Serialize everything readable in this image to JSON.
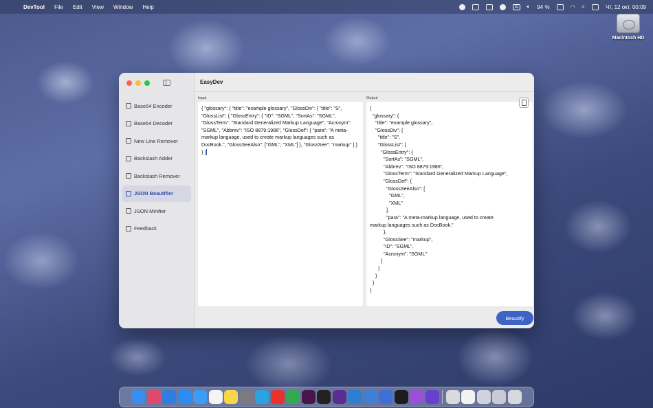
{
  "menubar": {
    "app_name": "DevTool",
    "menus": [
      "File",
      "Edit",
      "View",
      "Window",
      "Help"
    ],
    "battery": "94 %",
    "datetime": "Чт, 12 окт.  00:09",
    "input_source": "A"
  },
  "desktop": {
    "drive_label": "Macintosh HD"
  },
  "window": {
    "title": "EasyDev",
    "sidebar": [
      {
        "label": "Base64 Encoder",
        "icon": "lock-icon"
      },
      {
        "label": "Base64 Decoder",
        "icon": "unlock-icon"
      },
      {
        "label": "New Line Remover",
        "icon": "text-icon"
      },
      {
        "label": "Backslash Adder",
        "icon": "list-icon"
      },
      {
        "label": "Backslash Remover",
        "icon": "list-icon"
      },
      {
        "label": "JSON Beautifier",
        "icon": "doc-icon",
        "active": true
      },
      {
        "label": "JSON Minifier",
        "icon": "doc-icon"
      },
      {
        "label": "Feedback",
        "icon": "mail-icon"
      }
    ],
    "input_label": "Input",
    "output_label": "Output",
    "input_text": "{ \"glossary\": { \"title\": \"example glossary\", \"GlossDiv\": { \"title\": \"S\", \"GlossList\": { \"GlossEntry\": { \"ID\": \"SGML\", \"SortAs\": \"SGML\", \"GlossTerm\": \"Standard Generalized Markup Language\", \"Acronym\": \"SGML\", \"Abbrev\": \"ISO 8879:1986\", \"GlossDef\": { \"para\": \"A meta-markup language, used to create markup languages such as DocBook.\", \"GlossSeeAlso\": [\"GML\", \"XML\"] }, \"GlossSee\": \"markup\" } } } }",
    "output_text": "{\n  \"glossary\": {\n    \"title\": \"example glossary\",\n    \"GlossDiv\": {\n      \"title\": \"S\",\n      \"GlossList\": {\n        \"GlossEntry\": {\n          \"SortAs\": \"SGML\",\n          \"Abbrev\": \"ISO 8879:1986\",\n          \"GlossTerm\": \"Standard Generalized Markup Language\",\n          \"GlossDef\": {\n            \"GlossSeeAlso\": [\n              \"GML\",\n              \"XML\"\n            ],\n            \"para\": \"A meta-markup language, used to create\nmarkup languages such as DocBook.\"\n          },\n          \"GlossSee\": \"markup\",\n          \"ID\": \"SGML\",\n          \"Acronym\": \"SGML\"\n        }\n      }\n    }\n  }\n}",
    "beautify_label": "Beautify"
  },
  "dock": {
    "apps": [
      {
        "name": "finder-icon",
        "color": "#3a8ef0"
      },
      {
        "name": "launchpad-icon",
        "color": "#e04a6a"
      },
      {
        "name": "safari-icon",
        "color": "#2f7de1"
      },
      {
        "name": "app-store-icon",
        "color": "#2d8cf0"
      },
      {
        "name": "mail-icon",
        "color": "#3c9cf5"
      },
      {
        "name": "calendar-icon",
        "color": "#f4f4f4"
      },
      {
        "name": "notes-icon",
        "color": "#f7d64a"
      },
      {
        "name": "settings-icon",
        "color": "#7a7a80"
      },
      {
        "name": "telegram-icon",
        "color": "#2aa3e0"
      },
      {
        "name": "youtube-icon",
        "color": "#e8322d"
      },
      {
        "name": "chrome-icon",
        "color": "#34a853"
      },
      {
        "name": "slack-icon",
        "color": "#4a154b"
      },
      {
        "name": "terminal-icon",
        "color": "#222222"
      },
      {
        "name": "github-icon",
        "color": "#5a2d91"
      },
      {
        "name": "vscode-icon",
        "color": "#2a7fd0"
      },
      {
        "name": "xcode-icon",
        "color": "#3f7fd9"
      },
      {
        "name": "instruments-icon",
        "color": "#3c6fd8"
      },
      {
        "name": "code-editor-icon",
        "color": "#1d1d1f"
      },
      {
        "name": "podcasts-icon",
        "color": "#9b4fd8"
      },
      {
        "name": "devtool-icon",
        "color": "#6a3fd0"
      },
      {
        "name": "separator",
        "color": ""
      },
      {
        "name": "screenshot-icon",
        "color": "#d9d9de"
      },
      {
        "name": "document-icon",
        "color": "#f2f2f2"
      },
      {
        "name": "folder-stack-icon",
        "color": "#cfd3de"
      },
      {
        "name": "downloads-stack-icon",
        "color": "#c8cbd6"
      },
      {
        "name": "trash-icon",
        "color": "#d7d9de"
      }
    ]
  }
}
